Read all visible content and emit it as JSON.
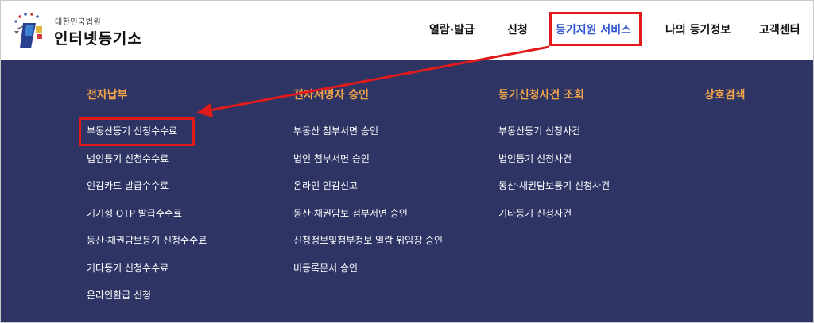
{
  "logo": {
    "sub": "대한민국법원",
    "title": "인터넷등기소"
  },
  "nav": [
    {
      "label": "열람·발급"
    },
    {
      "label": "신청"
    },
    {
      "label": "등기지원 서비스"
    },
    {
      "label": "나의 등기정보"
    },
    {
      "label": "고객센터"
    }
  ],
  "columns": [
    {
      "heading": "전자납부",
      "items": [
        "부동산등기 신청수수료",
        "법인등기 신청수수료",
        "인감카드 발급수수료",
        "기기형 OTP 발급수수료",
        "동산·채권담보등기 신청수수료",
        "기타등기 신청수수료",
        "온라인환급 신청"
      ]
    },
    {
      "heading": "전자서명자 승인",
      "items": [
        "부동산 첨부서면 승인",
        "법인 첨부서면 승인",
        "온라인 인감신고",
        "동산·채권담보 첨부서면 승인",
        "신청정보및첨부정보 열람 위임장 승인",
        "비등록문서 승인"
      ]
    },
    {
      "heading": "등기신청사건 조회",
      "items": [
        "부동산등기 신청사건",
        "법인등기 신청사건",
        "동산·채권담보등기 신청사건",
        "기타등기 신청사건"
      ]
    },
    {
      "heading": "상호검색",
      "items": []
    }
  ],
  "colors": {
    "panel": "#2e3565",
    "heading": "#f3a54a",
    "highlight": "#e11b1b",
    "active_nav": "#3056d3"
  }
}
